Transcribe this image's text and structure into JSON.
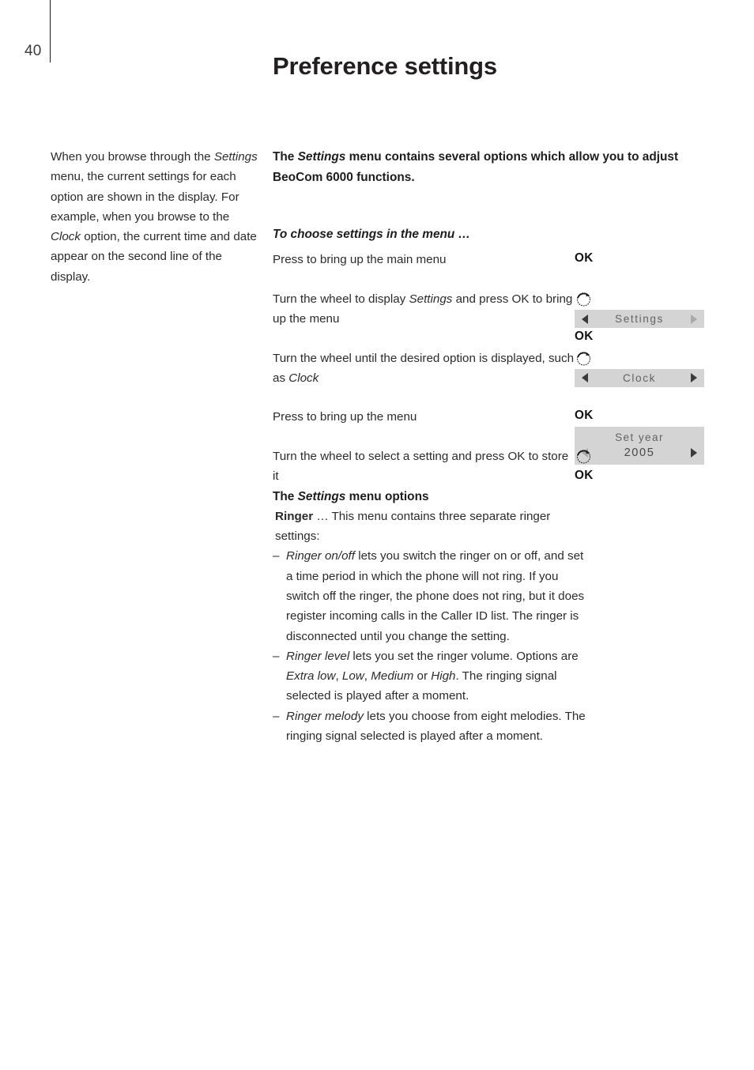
{
  "header": {
    "page_number": "40",
    "title": "Preference settings"
  },
  "left_column": {
    "paragraph_parts": [
      {
        "text": "When you browse through the ",
        "style": "normal"
      },
      {
        "text": "Settings",
        "style": "italic"
      },
      {
        "text": " menu, the current settings for each option are shown in the display. For example, when you browse to the ",
        "style": "normal"
      },
      {
        "text": "Clock",
        "style": "italic"
      },
      {
        "text": " option, the current time and date appear on the second line of the display.",
        "style": "normal"
      }
    ],
    "plain_text": "When you browse through the Settings menu, the current settings for each option are shown in the display. For example, when you browse to the Clock option, the current time and date appear on the second line of the display."
  },
  "main": {
    "intro_parts": [
      {
        "text": "The ",
        "style": "normal"
      },
      {
        "text": "Settings",
        "style": "italic"
      },
      {
        "text": " menu contains several options which allow you to adjust BeoCom 6000 functions.",
        "style": "normal"
      }
    ],
    "intro_plain": "The Settings menu contains several options which allow you to adjust BeoCom 6000 functions.",
    "sub_heading": "To choose settings in the menu …",
    "steps": [
      {
        "id": "step-1",
        "text_parts": [
          {
            "text": "Press to bring up the main menu",
            "style": "normal"
          }
        ],
        "side": [
          {
            "type": "ok",
            "label": "OK"
          }
        ]
      },
      {
        "id": "step-2",
        "text_parts": [
          {
            "text": "Turn the wheel to display ",
            "style": "normal"
          },
          {
            "text": "Settings",
            "style": "italic"
          },
          {
            "text": " and press OK to bring up the menu",
            "style": "normal"
          }
        ],
        "side": [
          {
            "type": "wheel",
            "label": "wheel-icon"
          },
          {
            "type": "bar",
            "label": "Settings",
            "left_arrow": "dark",
            "right_arrow": "muted"
          },
          {
            "type": "ok",
            "label": "OK"
          }
        ]
      },
      {
        "id": "step-3",
        "text_parts": [
          {
            "text": "Turn the wheel until the desired option is displayed, such as ",
            "style": "normal"
          },
          {
            "text": "Clock",
            "style": "italic"
          }
        ],
        "side": [
          {
            "type": "wheel",
            "label": "wheel-icon"
          },
          {
            "type": "bar",
            "label": "Clock",
            "left_arrow": "dark",
            "right_arrow": "dark"
          }
        ]
      },
      {
        "id": "step-4",
        "text_parts": [
          {
            "text": "Press to bring up the menu",
            "style": "normal"
          }
        ],
        "side": [
          {
            "type": "ok",
            "label": "OK"
          },
          {
            "type": "box",
            "title": "Set year",
            "value": "2005",
            "left_arrow": "muted",
            "right_arrow": "dark"
          }
        ]
      },
      {
        "id": "step-5",
        "text_parts": [
          {
            "text": "Turn the wheel to select a setting and press OK to store it",
            "style": "normal"
          }
        ],
        "side": [
          {
            "type": "wheel",
            "label": "wheel-icon"
          },
          {
            "type": "ok",
            "label": "OK"
          }
        ]
      }
    ],
    "options_section": {
      "heading_parts": [
        {
          "text": "The ",
          "style": "bold"
        },
        {
          "text": "Settings",
          "style": "bolditalic"
        },
        {
          "text": " menu options",
          "style": "bold"
        }
      ],
      "heading_plain": "The Settings menu options",
      "intro_parts": [
        {
          "text": "Ringer",
          "style": "bold"
        },
        {
          "text": " … This menu contains three separate ringer settings:",
          "style": "normal"
        }
      ],
      "bullets": [
        {
          "dash": "–",
          "parts": [
            {
              "text": "Ringer on/off",
              "style": "italic"
            },
            {
              "text": " lets you switch the ringer on or off, and set a time period in which the phone will not ring. If you switch off the ringer, the phone does not ring, but it does register incoming calls in the Caller ID list. The ringer is disconnected until you change the setting.",
              "style": "normal"
            }
          ]
        },
        {
          "dash": "–",
          "parts": [
            {
              "text": "Ringer level",
              "style": "italic"
            },
            {
              "text": " lets you set the ringer volume. Options are ",
              "style": "normal"
            },
            {
              "text": "Extra low",
              "style": "italic"
            },
            {
              "text": ", ",
              "style": "normal"
            },
            {
              "text": "Low",
              "style": "italic"
            },
            {
              "text": ", ",
              "style": "normal"
            },
            {
              "text": "Medium",
              "style": "italic"
            },
            {
              "text": " or ",
              "style": "normal"
            },
            {
              "text": "High",
              "style": "italic"
            },
            {
              "text": ". The ringing signal selected is played after a moment.",
              "style": "normal"
            }
          ]
        },
        {
          "dash": "–",
          "parts": [
            {
              "text": "Ringer melody",
              "style": "italic"
            },
            {
              "text": " lets you choose from eight melodies. The ringing signal selected is played after a moment.",
              "style": "normal"
            }
          ]
        }
      ]
    }
  },
  "colors": {
    "display_background": "#d4d4d4",
    "display_text": "#636363",
    "arrow_dark": "#3a3a3a",
    "arrow_muted": "#a9a9a9",
    "body_text": "#2b2b2b",
    "heading_text": "#231f20"
  }
}
